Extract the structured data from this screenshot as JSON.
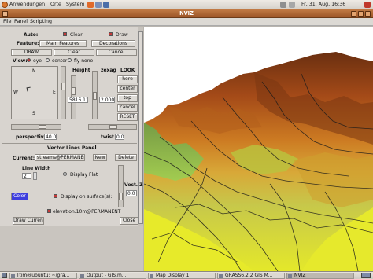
{
  "top_panel": {
    "menus": [
      "Anwendungen",
      "Orte",
      "System"
    ],
    "clock": "Fr, 31. Aug, 16:36"
  },
  "window": {
    "title": "NVIZ"
  },
  "menubar": [
    "File",
    "Panel",
    "Scripting"
  ],
  "controls": {
    "auto_label": "Auto:",
    "clear_check": "Clear",
    "draw_check": "Draw",
    "feature_label": "Feature:",
    "main_features": "Main Features",
    "decorations": "Decorations",
    "draw_btn": "DRAW",
    "clear_btn": "Clear",
    "cancel_btn": "Cancel",
    "view_label": "View:",
    "view_options": [
      "eye",
      "center",
      "fly none"
    ],
    "compass": {
      "n": "N",
      "s": "S",
      "w": "W",
      "e": "E"
    },
    "height_label": "Height",
    "height_value": "5816.11",
    "zexag_label": "zexag",
    "zexag_value": "2.000",
    "look_label": "LOOK",
    "look_buttons": [
      "here",
      "center",
      "top",
      "cancel",
      "RESET"
    ],
    "perspective_label": "perspective",
    "perspective_value": "40.0",
    "twist_label": "twist",
    "twist_value": "0.0"
  },
  "vector_panel": {
    "title": "Vector Lines Panel",
    "current_label": "Current:",
    "current_value": "streams@PERMANENT",
    "new_btn": "New",
    "delete_btn": "Delete",
    "line_width_label": "Line Width",
    "line_width_value": "2",
    "display_flat": "Display Flat",
    "color_btn": "Color",
    "display_on_surface": "Display on surface(s):",
    "surface": "elevation.10m@PERMANENT",
    "vect_z_label": "Vect. Z",
    "vect_z_value": "0.0",
    "draw_current": "Draw Current",
    "close": "Close"
  },
  "taskbar": {
    "tasks": [
      "[tim@ubuntu: ~/gra...",
      "Output - GIS.m...",
      "Map Display 1",
      "GRASS6.2.2 GIS M...",
      "NVIZ"
    ]
  },
  "colors": {
    "accent_title": "#b06530",
    "panel_bg": "#d8d4cf",
    "color_button": "#3d3ddd"
  }
}
